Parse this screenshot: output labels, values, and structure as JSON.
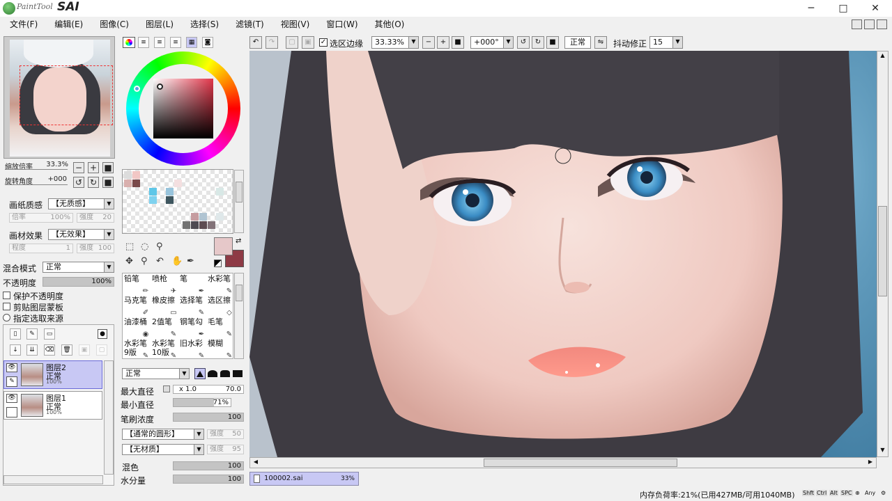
{
  "app": {
    "logo_text": "PaintTool",
    "logo_sai": "SAI"
  },
  "window_controls": {
    "minimize": "─",
    "maximize": "□",
    "close": "✕"
  },
  "menu": [
    "文件(F)",
    "编辑(E)",
    "图像(C)",
    "图层(L)",
    "选择(S)",
    "滤镜(T)",
    "视图(V)",
    "窗口(W)",
    "其他(O)"
  ],
  "navigator": {
    "zoom_label": "缩放倍率",
    "zoom_value": "33.3%",
    "rotate_label": "旋转角度",
    "rotate_value": "+000"
  },
  "paper": {
    "texture_label": "画纸质感",
    "texture_value": "【无质感】",
    "scale_label": "倍率",
    "scale_value": "100%",
    "strength_label": "强度",
    "strength_value": "20",
    "effect_label": "画材效果",
    "effect_value": "【无效果】",
    "degree_label": "程度",
    "degree_value": "1",
    "strength2_label": "强度",
    "strength2_value": "100"
  },
  "layer_props": {
    "blend_label": "混合模式",
    "blend_value": "正常",
    "opacity_label": "不透明度",
    "opacity_value": "100%",
    "opacity_fraction": 1.0,
    "preserve_opacity": "保护不透明度",
    "clip_group": "剪贴图层蒙板",
    "selection_source": "指定选取来源"
  },
  "layers": [
    {
      "name": "图层2",
      "mode": "正常",
      "opacity": "100%",
      "selected": true
    },
    {
      "name": "图层1",
      "mode": "正常",
      "opacity": "100%",
      "selected": false
    }
  ],
  "brush": {
    "tools": [
      {
        "name": "铅笔",
        "icon": "pencil-icon"
      },
      {
        "name": "喷枪",
        "icon": "airbrush-icon"
      },
      {
        "name": "笔",
        "icon": "brush-icon"
      },
      {
        "name": "水彩笔",
        "icon": "watercolor-icon"
      },
      {
        "name": "马克笔",
        "icon": "marker-icon"
      },
      {
        "name": "橡皮擦",
        "icon": "eraser-icon"
      },
      {
        "name": "选择笔",
        "icon": "select-pen-icon"
      },
      {
        "name": "选区擦",
        "icon": "select-eraser-icon"
      },
      {
        "name": "油漆桶",
        "icon": "bucket-icon"
      },
      {
        "name": "2值笔",
        "icon": "binary-pen-icon"
      },
      {
        "name": "钢笔勾",
        "icon": "pen-line-icon"
      },
      {
        "name": "毛笔",
        "icon": "ink-brush-icon"
      },
      {
        "name": "水彩笔\n9版",
        "icon": "watercolor9-icon"
      },
      {
        "name": "水彩笔\n10版",
        "icon": "watercolor10-icon"
      },
      {
        "name": "旧水彩",
        "icon": "old-watercolor-icon"
      },
      {
        "name": "模糊",
        "icon": "blur-icon"
      }
    ],
    "mode_value": "正常",
    "max_size_label": "最大直径",
    "max_size_mult": "x 1.0",
    "max_size_value": "70.0",
    "min_size_label": "最小直径",
    "min_size_value": "71%",
    "min_size_fraction": 0.71,
    "density_label": "笔刷浓度",
    "density_value": "100",
    "density_fraction": 1.0,
    "shape_value": "【通常的圆形】",
    "shape_strength_label": "强度",
    "shape_strength_value": "50",
    "texture_value": "【无材质】",
    "texture_strength_label": "强度",
    "texture_strength_value": "95",
    "blend_label": "混色",
    "blend_value": "100",
    "blend_fraction": 1.0,
    "water_label": "水分量",
    "water_value": "100",
    "water_fraction": 1.0
  },
  "canvas_toolbar": {
    "selection_edge_label": "选区边缘",
    "selection_edge_checked": true,
    "zoom_value": "33.33%",
    "rotate_value": "+000°",
    "mode_value": "正常",
    "stabilizer_label": "抖动修正",
    "stabilizer_value": "15"
  },
  "document_tab": {
    "name": "100002.sai",
    "zoom": "33%"
  },
  "status": {
    "memory_text": "内存负荷率:21%(已用427MB/可用1040MB)",
    "keys": [
      "Shft",
      "Ctrl",
      "Alt",
      "SPC",
      "Any"
    ]
  },
  "colors": {
    "foreground": "#8e3a45",
    "background": "#e6c8c9",
    "accent_selection": "#c8c8f4"
  },
  "swatch_colors": [
    "#dcdcdc",
    "#f2c7c5",
    "#7a4a4a",
    "#d9b0ae",
    "#5fc7e8",
    "#7fd2ef",
    "#98c4dc",
    "#3e565f",
    "#f4dfe0",
    "#d8e8e6",
    "#727272",
    "#5e4c52",
    "#827278",
    "#dfe8ea",
    "#c69ca0",
    "#b0c4d2",
    "#4e4a52"
  ]
}
